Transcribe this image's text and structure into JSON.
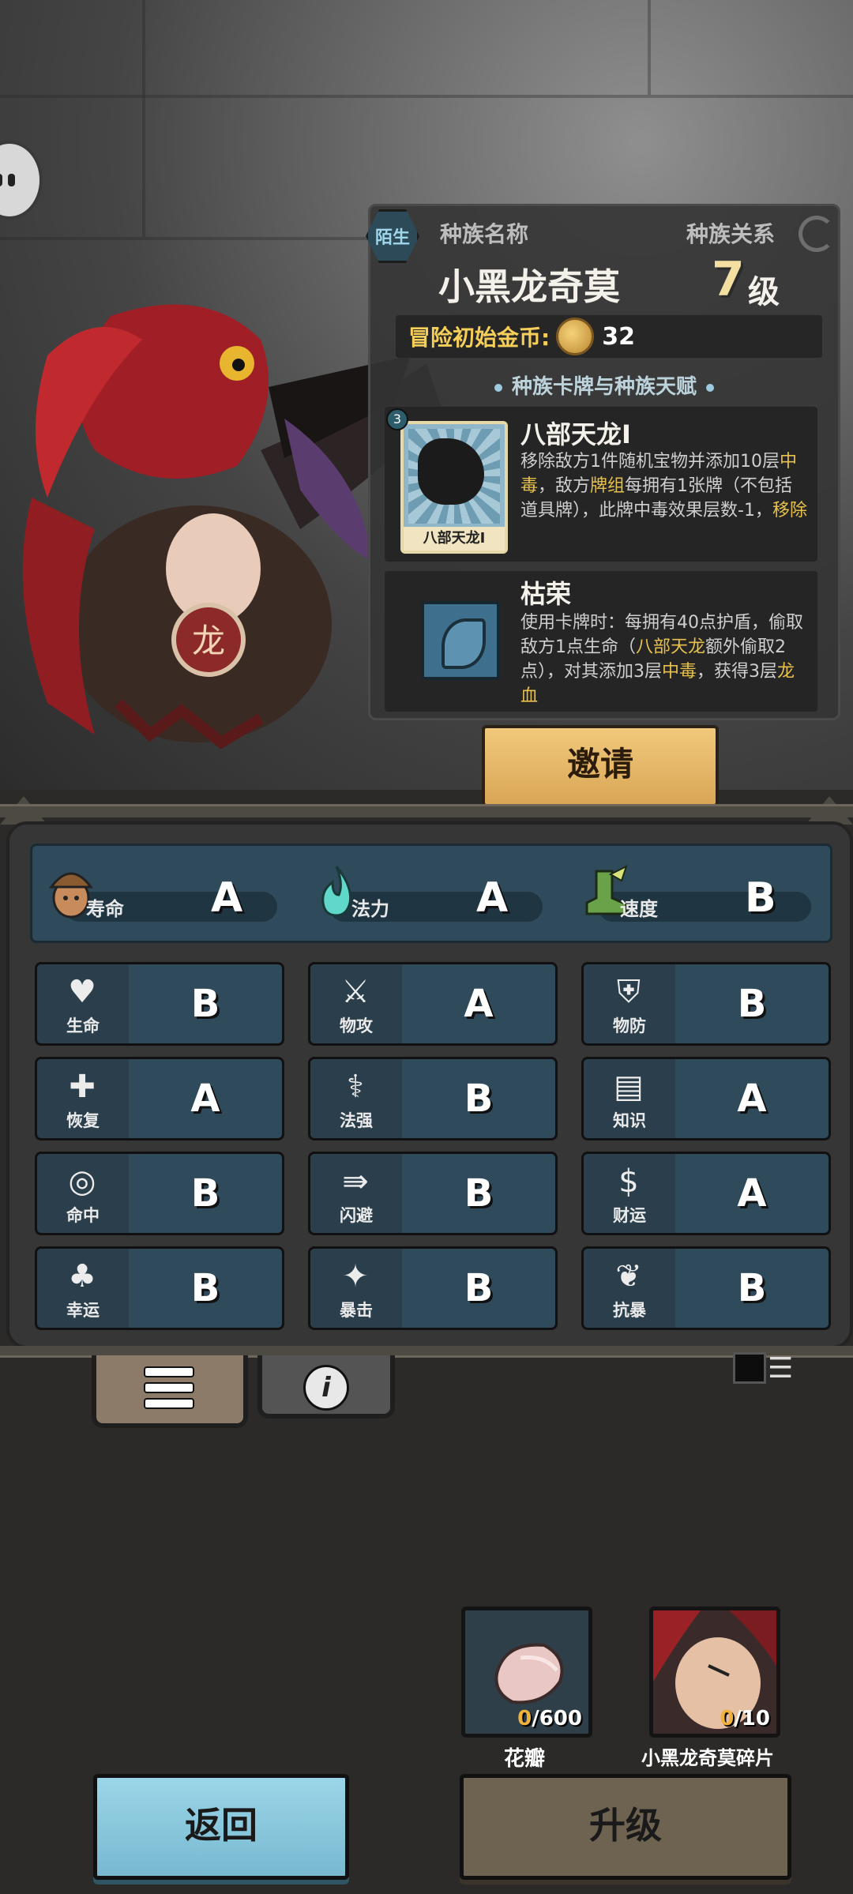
{
  "race": {
    "tag": "陌生",
    "name_header": "种族名称",
    "relation_header": "种族关系",
    "name": "小黑龙奇莫",
    "level_number": "7",
    "level_unit": "级",
    "gold_label": "冒险初始金币:",
    "gold_value": "32",
    "section_title": "种族卡牌与种族天赋"
  },
  "card": {
    "cost": "3",
    "caption": "八部天龙I",
    "name": "八部天龙I",
    "desc_parts": [
      "移除敌方1件随机宝物并添加10层",
      "中毒",
      "，敌方",
      "牌组",
      "每拥有1张牌（不包括道具牌），此牌中毒效果层数-1，",
      "移除"
    ]
  },
  "talent": {
    "name": "枯荣",
    "desc_parts": [
      "使用卡牌时：每拥有40点护盾，偷取敌方1点生命（",
      "八部天龙",
      "额外偷取2点），对其添加3层",
      "中毒",
      "，获得3层",
      "龙血"
    ]
  },
  "invite_label": "邀请",
  "summary": [
    {
      "icon": "lifespan-icon",
      "label": "寿命",
      "grade": "A"
    },
    {
      "icon": "mana-flame-icon",
      "label": "法力",
      "grade": "A"
    },
    {
      "icon": "speed-boot-icon",
      "label": "速度",
      "grade": "B"
    }
  ],
  "stats": [
    {
      "icon": "heart-icon",
      "glyph": "♥",
      "label": "生命",
      "grade": "B"
    },
    {
      "icon": "sword-icon",
      "glyph": "⚔",
      "label": "物攻",
      "grade": "A"
    },
    {
      "icon": "armor-icon",
      "glyph": "⛨",
      "label": "物防",
      "grade": "B"
    },
    {
      "icon": "heal-heart-icon",
      "glyph": "✚",
      "label": "恢复",
      "grade": "A"
    },
    {
      "icon": "staff-icon",
      "glyph": "⚕",
      "label": "法强",
      "grade": "B"
    },
    {
      "icon": "book-icon",
      "glyph": "▤",
      "label": "知识",
      "grade": "A"
    },
    {
      "icon": "target-icon",
      "glyph": "◎",
      "label": "命中",
      "grade": "B"
    },
    {
      "icon": "dodge-arrows-icon",
      "glyph": "⇛",
      "label": "闪避",
      "grade": "B"
    },
    {
      "icon": "coin-icon",
      "glyph": "$",
      "label": "财运",
      "grade": "A"
    },
    {
      "icon": "clover-icon",
      "glyph": "♣",
      "label": "幸运",
      "grade": "B"
    },
    {
      "icon": "crit-burst-icon",
      "glyph": "✦",
      "label": "暴击",
      "grade": "B"
    },
    {
      "icon": "shield-burst-icon",
      "glyph": "❦",
      "label": "抗暴",
      "grade": "B"
    }
  ],
  "materials": [
    {
      "icon": "petal-icon",
      "have": "0",
      "need": "/600",
      "name": "花瓣"
    },
    {
      "icon": "fragment-portrait-icon",
      "have": "0",
      "need": "/10",
      "name": "小黑龙奇莫碎片"
    }
  ],
  "back_label": "返回",
  "upgrade_label": "升级",
  "colors": {
    "highlight": "#e8c14d",
    "panel": "#2f4a5a",
    "gold": "#f5cf59"
  }
}
